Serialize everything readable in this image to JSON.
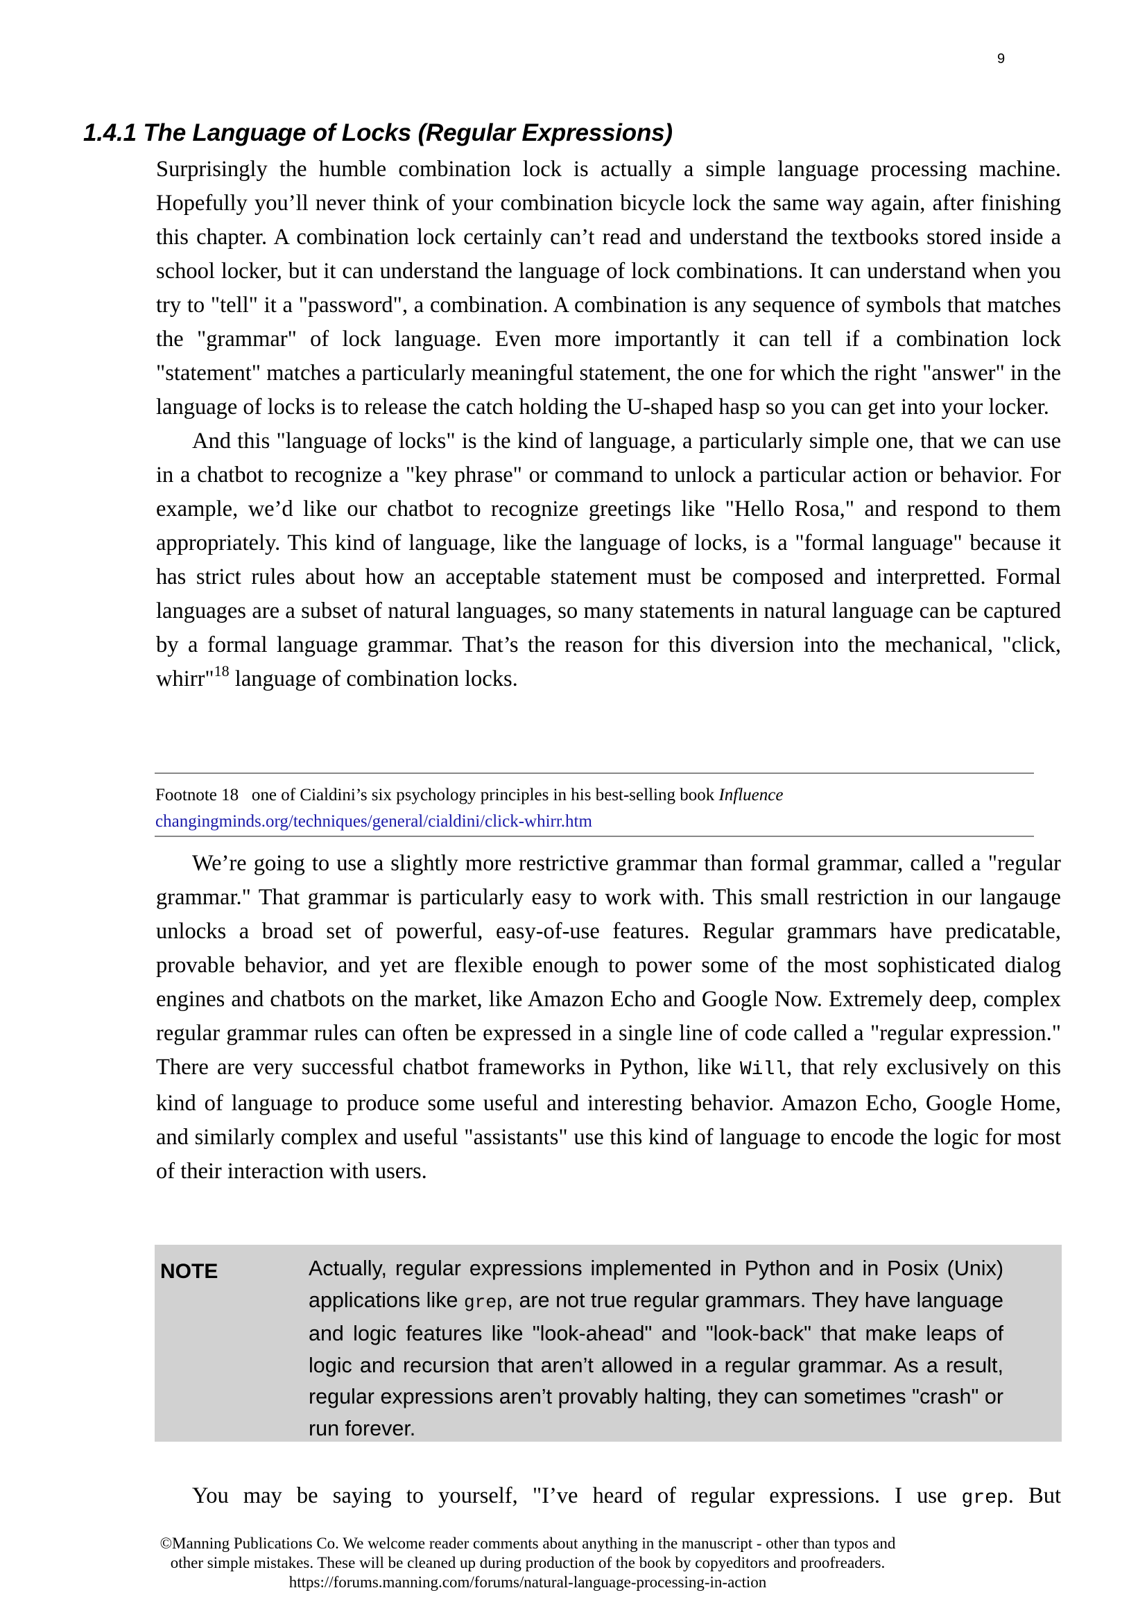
{
  "page": {
    "number": "9"
  },
  "section": {
    "heading": "1.4.1 The Language of Locks (Regular Expressions)"
  },
  "paragraphs": {
    "p1": "Surprisingly the humble combination lock is actually a simple language processing machine. Hopefully you’ll never think of your combination bicycle lock the same way again, after finishing this chapter. A combination lock certainly can’t read and understand the textbooks stored inside a school locker, but it can understand the language of lock combinations. It can understand when you try to \"tell\" it a \"password\", a combination. A combination is any sequence of symbols that matches the \"grammar\" of lock language. Even more importantly it can tell if a combination lock \"statement\" matches a particularly meaningful statement, the one for which the right \"answer\" in the language of locks is to release the catch holding the U-shaped hasp so you can get into your locker.",
    "p2": "And this \"language of locks\" is the kind of language, a particularly simple one, that we can use in a chatbot to recognize a \"key phrase\" or command to unlock a particular action or behavior. For example, we’d like our chatbot to recognize greetings like \"Hello Rosa,\" and respond to them appropriately. This kind of language, like the language of locks, is a \"formal language\" because it has strict rules about how an acceptable statement must be composed and interpretted. Formal languages are a subset of natural languages, so many statements in natural language can be captured by a formal language grammar. That’s the reason for this diversion into the mechanical, \"click, whirr\"",
    "p2_footnote_ref": "18",
    "p2_end": "language of combination locks.",
    "p3_before_code": "We’re going to use a slightly more restrictive grammar than formal grammar, called a \"regular grammar.\" That grammar is particularly easy to work with. This small restriction in our langauge unlocks a broad set of powerful, easy-of-use features. Regular grammars have predicatable, provable behavior, and yet are flexible enough to power some of the most sophisticated dialog engines and chatbots on the market, like Amazon Echo and Google Now. Extremely deep, complex regular grammar rules can often be expressed in a single line of code called a \"regular expression.\" There are very successful chatbot frameworks in Python, like ",
    "p3_code": "Will",
    "p3_after_code": ", that rely exclusively on this kind of language to produce some useful and interesting behavior. Amazon Echo, Google Home, and similarly complex and useful \"assistants\" use this kind of language to encode the logic for most of their interaction with users.",
    "p4_before_code": "You may be saying to yourself, \"I’ve heard of regular expressions. I use ",
    "p4_code": "grep",
    "p4_after_code": ". But"
  },
  "footnote": {
    "label": "Footnote 18",
    "text": "one of Cialdini’s six psychology principles in his best-selling book ",
    "book_title": "Influence",
    "link_text": "changingminds.org/techniques/general/cialdini/click-whirr.htm"
  },
  "note": {
    "label": "NOTE",
    "text_before_code": "Actually, regular expressions implemented in Python and in Posix (Unix) applications like ",
    "code": "grep",
    "text_after_code": ", are not true regular grammars. They have language and logic features like \"look-ahead\" and \"look-back\" that make leaps of logic and recursion that aren’t allowed in a regular grammar. As a result, regular expressions aren’t provably halting, they can sometimes \"crash\" or run forever."
  },
  "footer": {
    "line1": "©Manning Publications Co. We welcome reader comments about anything in the manuscript - other than typos and",
    "line2": "other simple mistakes. These will be cleaned up during production of the book by copyeditors and proofreaders.",
    "line3": "https://forums.manning.com/forums/natural-language-processing-in-action"
  }
}
